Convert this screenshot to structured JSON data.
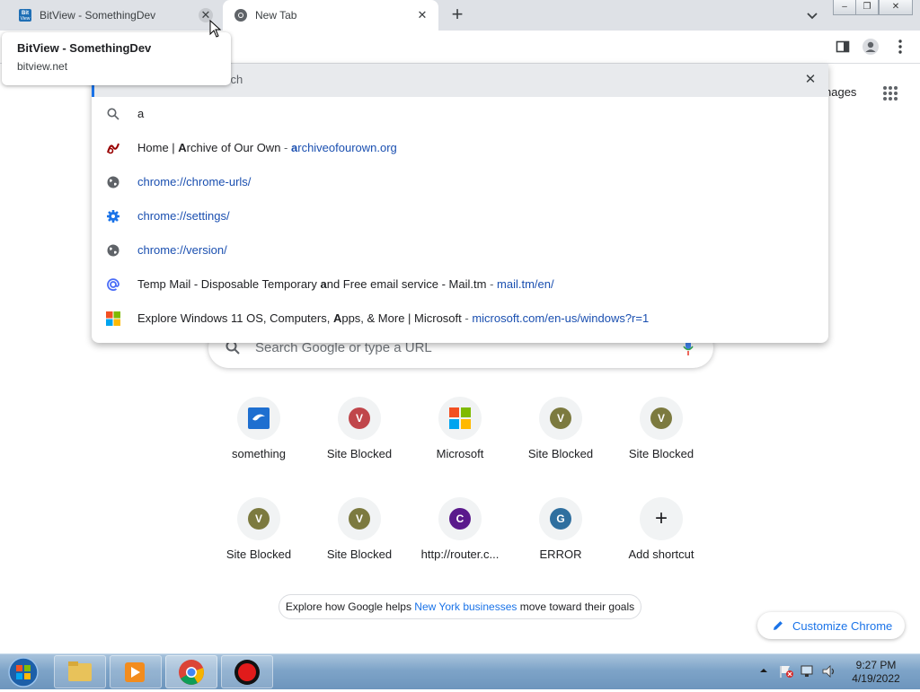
{
  "browser": {
    "tabs": [
      {
        "title": "BitView - SomethingDev",
        "favicon": "bitview-icon",
        "active": false
      },
      {
        "title": "New Tab",
        "favicon": "chrome-icon",
        "active": true
      }
    ],
    "tab_close_glyph": "✕",
    "new_tab_glyph": "+",
    "window_buttons": {
      "minimize": "–",
      "restore": "❐",
      "close": "✕"
    }
  },
  "hover_card": {
    "title": "BitView - SomethingDev",
    "url": "bitview.net"
  },
  "omnibox": {
    "hint_visible": "arch",
    "typed": "a",
    "suggestions": [
      {
        "icon": "ao3-icon",
        "title_pre": "Home | ",
        "title_bold": "A",
        "title_post": "rchive of Our Own",
        "sep": " - ",
        "url_bold": "a",
        "url_rest": "rchiveofourown.org"
      },
      {
        "icon": "globe-icon",
        "url": "chrome://chrome-urls/"
      },
      {
        "icon": "settings-gear-icon",
        "url": "chrome://settings/"
      },
      {
        "icon": "globe-icon",
        "url": "chrome://version/"
      },
      {
        "icon": "mail-tm-icon",
        "title_pre": "Temp Mail - Disposable Temporary ",
        "title_bold": "a",
        "title_post": "nd Free email service - Mail.tm",
        "sep": " - ",
        "url": "mail.tm/en/"
      },
      {
        "icon": "microsoft-icon",
        "title_pre": "Explore Windows 11 OS, Computers, ",
        "title_bold": "A",
        "title_post": "pps, & More | Microsoft",
        "sep": " - ",
        "url": "microsoft.com/en-us/windows?r=1"
      }
    ]
  },
  "ntp": {
    "images_link": "nages",
    "search_placeholder": "Search Google or type a URL",
    "shortcuts": [
      {
        "label": "something",
        "icon": "something-icon"
      },
      {
        "label": "Site Blocked",
        "letter": "V",
        "color": "#c0464b"
      },
      {
        "label": "Microsoft",
        "icon": "microsoft-icon"
      },
      {
        "label": "Site Blocked",
        "letter": "V",
        "color": "#7c7a3f"
      },
      {
        "label": "Site Blocked",
        "letter": "V",
        "color": "#7c7a3f"
      },
      {
        "label": "Site Blocked",
        "letter": "V",
        "color": "#7c7a3f"
      },
      {
        "label": "Site Blocked",
        "letter": "V",
        "color": "#7c7a3f"
      },
      {
        "label": "http://router.c...",
        "letter": "C",
        "color": "#5a1a8c"
      },
      {
        "label": "ERROR",
        "letter": "G",
        "color": "#2f6f9f"
      },
      {
        "label": "Add shortcut",
        "icon": "plus-icon",
        "glyph": "+"
      }
    ],
    "promo": {
      "pre": "Explore how Google helps ",
      "link": "New York businesses",
      "post": " move toward their goals"
    },
    "customize_label": "Customize Chrome"
  },
  "taskbar": {
    "time": "9:27 PM",
    "date": "4/19/2022"
  }
}
